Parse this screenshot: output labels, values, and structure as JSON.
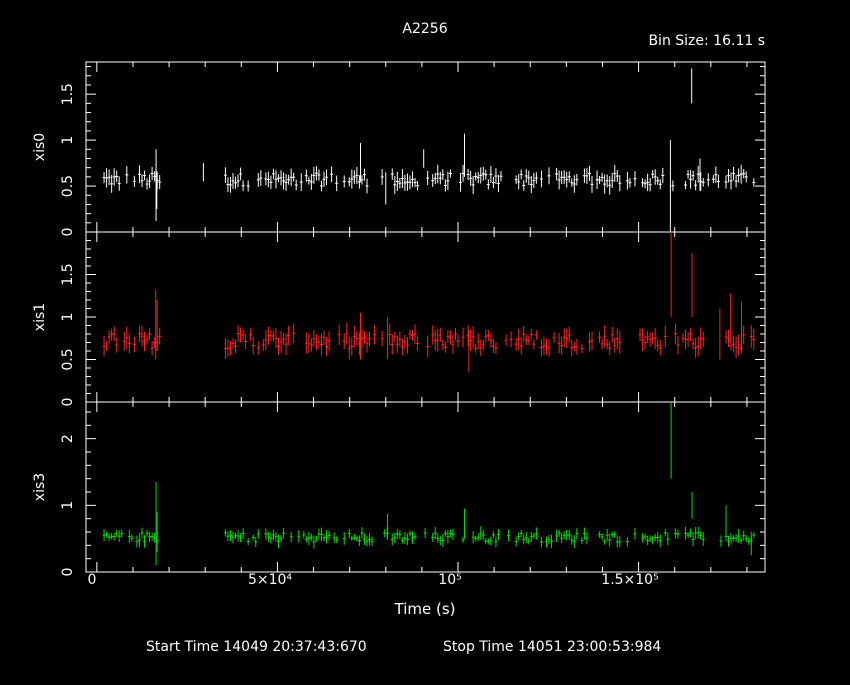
{
  "chart_data": {
    "type": "line",
    "title": "A2256",
    "bin_size_label": "Bin Size: 16.11 s",
    "xlabel": "Time (s)",
    "xlim": [
      -3000,
      185000
    ],
    "x_tick_labels": [
      "0",
      "5×10⁴",
      "10⁵",
      "1.5×10⁵"
    ],
    "footer": {
      "start_time": "Start Time 14049 20:37:43:670",
      "stop_time": "Stop Time 14051 23:00:53:984"
    },
    "gaps": [
      [
        18000,
        35000
      ]
    ],
    "t_range": [
      2000,
      182500
    ],
    "panels": [
      {
        "ylabel": "xis0",
        "color": "#ffffff",
        "ylim": [
          0,
          1.85
        ],
        "y_ticks": [
          "0",
          "0.5",
          "1",
          "1.5"
        ],
        "baseline": 0.57,
        "noise": 0.07,
        "spikes": [
          [
            16400,
            0.12,
            0.9
          ],
          [
            16600,
            0.25,
            0.65
          ],
          [
            29500,
            0.55,
            0.75
          ],
          [
            73000,
            0.55,
            0.97
          ],
          [
            80000,
            0.3,
            0.65
          ],
          [
            90500,
            0.7,
            0.9
          ],
          [
            101800,
            0.6,
            1.07
          ],
          [
            158800,
            0.0,
            1.0
          ],
          [
            164700,
            1.4,
            1.78
          ],
          [
            167000,
            0.45,
            0.8
          ]
        ]
      },
      {
        "ylabel": "xis1",
        "color": "#ff2020",
        "ylim": [
          0,
          2.0
        ],
        "y_ticks": [
          "0",
          "0.5",
          "1",
          "1.5"
        ],
        "baseline": 0.72,
        "noise": 0.09,
        "spikes": [
          [
            16300,
            0.5,
            1.32
          ],
          [
            16700,
            0.6,
            1.2
          ],
          [
            73000,
            0.5,
            1.05
          ],
          [
            80500,
            0.5,
            1.0
          ],
          [
            103000,
            0.35,
            0.85
          ],
          [
            159000,
            1.0,
            2.0
          ],
          [
            164800,
            1.0,
            1.75
          ],
          [
            172500,
            0.5,
            1.1
          ],
          [
            175500,
            0.7,
            1.28
          ],
          [
            178500,
            0.6,
            1.18
          ]
        ]
      },
      {
        "ylabel": "xis3",
        "color": "#00dd00",
        "ylim": [
          0,
          2.55
        ],
        "y_ticks": [
          "0",
          "1",
          "2"
        ],
        "baseline": 0.52,
        "noise": 0.07,
        "spikes": [
          [
            16400,
            0.1,
            1.35
          ],
          [
            16700,
            0.3,
            0.9
          ],
          [
            80500,
            0.5,
            0.87
          ],
          [
            101800,
            0.5,
            0.95
          ],
          [
            159000,
            1.4,
            2.55
          ],
          [
            164800,
            0.8,
            1.2
          ],
          [
            174200,
            0.6,
            1.0
          ],
          [
            181200,
            0.25,
            0.6
          ]
        ]
      }
    ]
  }
}
